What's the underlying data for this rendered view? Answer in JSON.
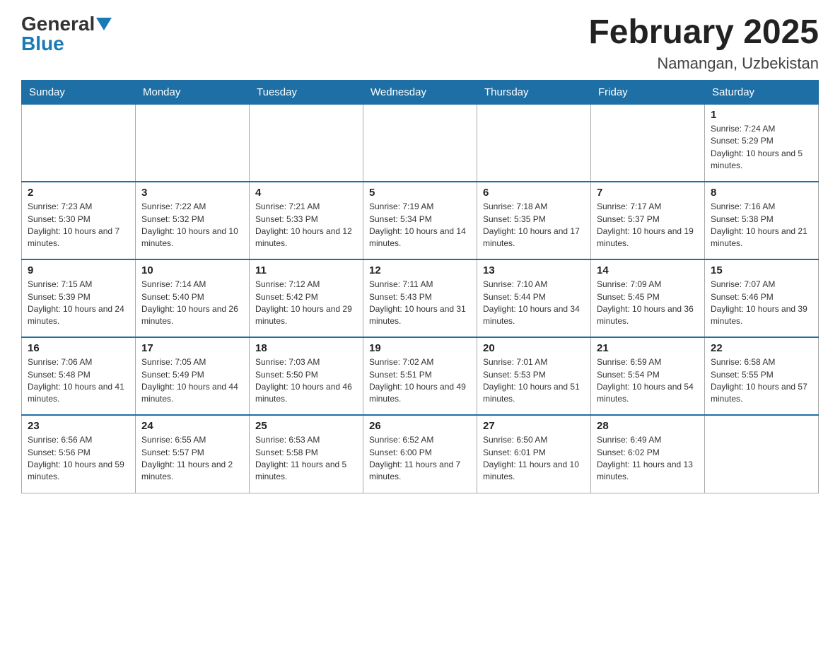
{
  "header": {
    "logo": {
      "general": "General",
      "blue": "Blue"
    },
    "title": "February 2025",
    "location": "Namangan, Uzbekistan"
  },
  "days_of_week": [
    "Sunday",
    "Monday",
    "Tuesday",
    "Wednesday",
    "Thursday",
    "Friday",
    "Saturday"
  ],
  "weeks": [
    [
      {
        "day": "",
        "info": ""
      },
      {
        "day": "",
        "info": ""
      },
      {
        "day": "",
        "info": ""
      },
      {
        "day": "",
        "info": ""
      },
      {
        "day": "",
        "info": ""
      },
      {
        "day": "",
        "info": ""
      },
      {
        "day": "1",
        "info": "Sunrise: 7:24 AM\nSunset: 5:29 PM\nDaylight: 10 hours and 5 minutes."
      }
    ],
    [
      {
        "day": "2",
        "info": "Sunrise: 7:23 AM\nSunset: 5:30 PM\nDaylight: 10 hours and 7 minutes."
      },
      {
        "day": "3",
        "info": "Sunrise: 7:22 AM\nSunset: 5:32 PM\nDaylight: 10 hours and 10 minutes."
      },
      {
        "day": "4",
        "info": "Sunrise: 7:21 AM\nSunset: 5:33 PM\nDaylight: 10 hours and 12 minutes."
      },
      {
        "day": "5",
        "info": "Sunrise: 7:19 AM\nSunset: 5:34 PM\nDaylight: 10 hours and 14 minutes."
      },
      {
        "day": "6",
        "info": "Sunrise: 7:18 AM\nSunset: 5:35 PM\nDaylight: 10 hours and 17 minutes."
      },
      {
        "day": "7",
        "info": "Sunrise: 7:17 AM\nSunset: 5:37 PM\nDaylight: 10 hours and 19 minutes."
      },
      {
        "day": "8",
        "info": "Sunrise: 7:16 AM\nSunset: 5:38 PM\nDaylight: 10 hours and 21 minutes."
      }
    ],
    [
      {
        "day": "9",
        "info": "Sunrise: 7:15 AM\nSunset: 5:39 PM\nDaylight: 10 hours and 24 minutes."
      },
      {
        "day": "10",
        "info": "Sunrise: 7:14 AM\nSunset: 5:40 PM\nDaylight: 10 hours and 26 minutes."
      },
      {
        "day": "11",
        "info": "Sunrise: 7:12 AM\nSunset: 5:42 PM\nDaylight: 10 hours and 29 minutes."
      },
      {
        "day": "12",
        "info": "Sunrise: 7:11 AM\nSunset: 5:43 PM\nDaylight: 10 hours and 31 minutes."
      },
      {
        "day": "13",
        "info": "Sunrise: 7:10 AM\nSunset: 5:44 PM\nDaylight: 10 hours and 34 minutes."
      },
      {
        "day": "14",
        "info": "Sunrise: 7:09 AM\nSunset: 5:45 PM\nDaylight: 10 hours and 36 minutes."
      },
      {
        "day": "15",
        "info": "Sunrise: 7:07 AM\nSunset: 5:46 PM\nDaylight: 10 hours and 39 minutes."
      }
    ],
    [
      {
        "day": "16",
        "info": "Sunrise: 7:06 AM\nSunset: 5:48 PM\nDaylight: 10 hours and 41 minutes."
      },
      {
        "day": "17",
        "info": "Sunrise: 7:05 AM\nSunset: 5:49 PM\nDaylight: 10 hours and 44 minutes."
      },
      {
        "day": "18",
        "info": "Sunrise: 7:03 AM\nSunset: 5:50 PM\nDaylight: 10 hours and 46 minutes."
      },
      {
        "day": "19",
        "info": "Sunrise: 7:02 AM\nSunset: 5:51 PM\nDaylight: 10 hours and 49 minutes."
      },
      {
        "day": "20",
        "info": "Sunrise: 7:01 AM\nSunset: 5:53 PM\nDaylight: 10 hours and 51 minutes."
      },
      {
        "day": "21",
        "info": "Sunrise: 6:59 AM\nSunset: 5:54 PM\nDaylight: 10 hours and 54 minutes."
      },
      {
        "day": "22",
        "info": "Sunrise: 6:58 AM\nSunset: 5:55 PM\nDaylight: 10 hours and 57 minutes."
      }
    ],
    [
      {
        "day": "23",
        "info": "Sunrise: 6:56 AM\nSunset: 5:56 PM\nDaylight: 10 hours and 59 minutes."
      },
      {
        "day": "24",
        "info": "Sunrise: 6:55 AM\nSunset: 5:57 PM\nDaylight: 11 hours and 2 minutes."
      },
      {
        "day": "25",
        "info": "Sunrise: 6:53 AM\nSunset: 5:58 PM\nDaylight: 11 hours and 5 minutes."
      },
      {
        "day": "26",
        "info": "Sunrise: 6:52 AM\nSunset: 6:00 PM\nDaylight: 11 hours and 7 minutes."
      },
      {
        "day": "27",
        "info": "Sunrise: 6:50 AM\nSunset: 6:01 PM\nDaylight: 11 hours and 10 minutes."
      },
      {
        "day": "28",
        "info": "Sunrise: 6:49 AM\nSunset: 6:02 PM\nDaylight: 11 hours and 13 minutes."
      },
      {
        "day": "",
        "info": ""
      }
    ]
  ]
}
